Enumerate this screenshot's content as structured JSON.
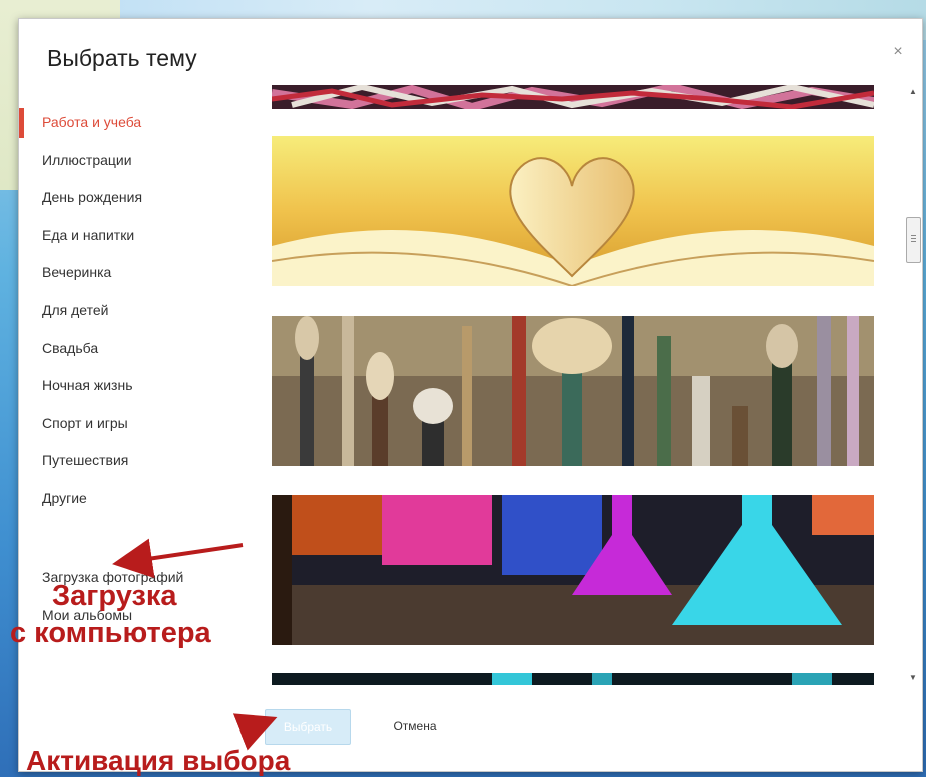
{
  "dialog": {
    "title": "Выбрать тему",
    "close_glyph": "×"
  },
  "nav": {
    "items": [
      {
        "label": "Работа и учеба",
        "active": true
      },
      {
        "label": "Иллюстрации"
      },
      {
        "label": "День рождения"
      },
      {
        "label": "Еда и напитки"
      },
      {
        "label": "Вечеринка"
      },
      {
        "label": "Для детей"
      },
      {
        "label": "Свадьба"
      },
      {
        "label": "Ночная жизнь"
      },
      {
        "label": "Спорт и игры"
      },
      {
        "label": "Путешествия"
      },
      {
        "label": "Другие"
      }
    ],
    "upload_label": "Загрузка фотографий",
    "albums_label": "Мои альбомы"
  },
  "thumbnails": [
    {
      "name": "threads-image"
    },
    {
      "name": "book-heart-image"
    },
    {
      "name": "paint-brushes-image"
    },
    {
      "name": "lab-flasks-image"
    },
    {
      "name": "partial-image"
    }
  ],
  "buttons": {
    "select_label": "Выбрать",
    "cancel_label": "Отмена"
  },
  "annotations": {
    "upload_line1": "Загрузка",
    "upload_line2": "с компьютера",
    "activate": "Активация выбора",
    "color": "#b81c1c"
  },
  "colors": {
    "accent": "#dd4b39",
    "select_button": "#d7ecf8"
  }
}
